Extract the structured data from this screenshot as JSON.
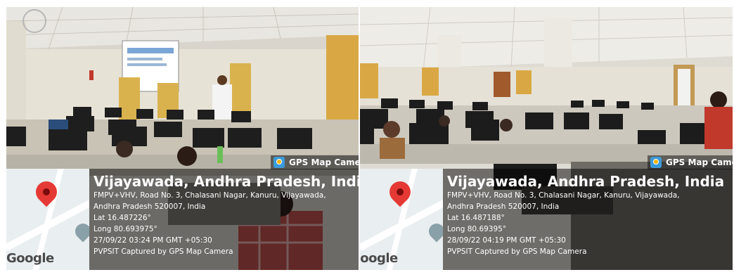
{
  "badge_label": "GPS Map Camera",
  "map_logo": "Google",
  "photos": [
    {
      "place": "Vijayawada, Andhra Pradesh, India",
      "address_line1": "FMPV+VHV, Road No. 3, Chalasani Nagar, Kanuru, Vijayawada,",
      "address_line2": "Andhra Pradesh 520007, India",
      "lat": "Lat 16.487226°",
      "long": "Long 80.693975°",
      "datetime": "27/09/22 03:24 PM GMT +05:30",
      "caption": "PVPSIT Captured by GPS Map Camera"
    },
    {
      "place": "Vijayawada, Andhra Pradesh, India",
      "address_line1": "FMPV+VHV, Road No. 3, Chalasani Nagar, Kanuru, Vijayawada,",
      "address_line2": "Andhra Pradesh 520007, India",
      "lat": "Lat 16.487188°",
      "long": "Long 80.69395°",
      "datetime": "28/09/22 04:19 PM GMT +05:30",
      "caption": "PVPSIT Captured by GPS Map Camera"
    }
  ]
}
